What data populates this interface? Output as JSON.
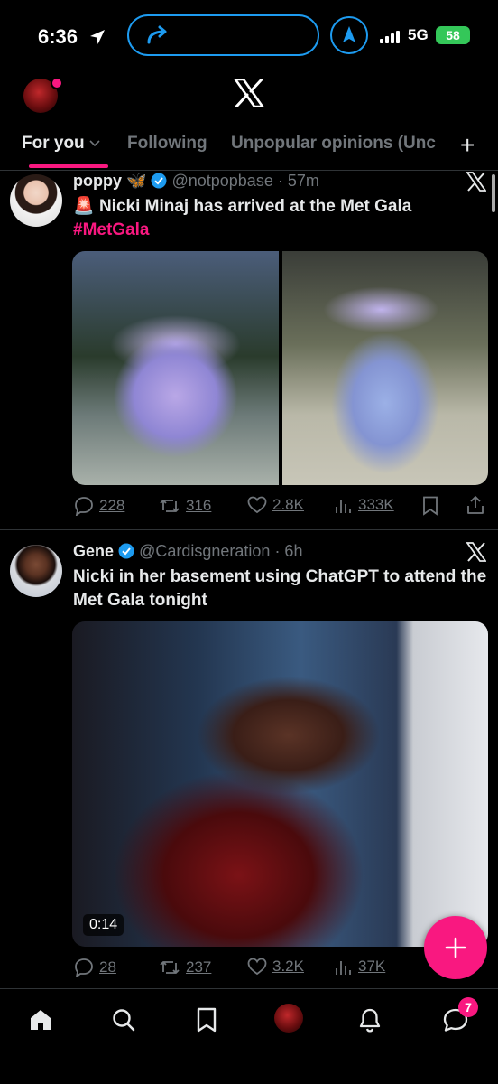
{
  "status_bar": {
    "time": "6:36",
    "network": "5G",
    "battery": "58",
    "icons": [
      "location-arrow-icon",
      "share-arrow-icon",
      "navigation-icon",
      "signal-bars-icon",
      "battery-icon"
    ]
  },
  "header": {
    "logo": "x-logo-icon",
    "notification_dot_color": "#f91880"
  },
  "tabs": [
    {
      "label": "For you",
      "active": true
    },
    {
      "label": "Following",
      "active": false
    },
    {
      "label": "Unpopular opinions (Unc",
      "active": false
    }
  ],
  "tabs_add_label": "+",
  "tweets": [
    {
      "name": "poppy",
      "name_suffix": "🦋",
      "verified": true,
      "handle": "@notpopbase",
      "time": "· 57m",
      "emoji": "🚨",
      "text": "Nicki Minaj has arrived at the Met Gala",
      "hashtag": "#MetGala",
      "replies": "228",
      "reposts": "316",
      "likes": "2.8K",
      "views": "333K"
    },
    {
      "name": "Gene",
      "verified": true,
      "handle": "@Cardisgneration",
      "time": "· 6h",
      "text": "Nicki in her basement using ChatGPT to attend the Met Gala tonight",
      "video_duration": "0:14",
      "replies": "28",
      "reposts": "237",
      "likes": "3.2K",
      "views": "37K"
    }
  ],
  "fab_label": "+",
  "bottom_nav": {
    "items": [
      "home-icon",
      "search-icon",
      "bookmark-icon",
      "profile-avatar",
      "notifications-icon",
      "messages-icon"
    ],
    "messages_badge": "7"
  },
  "colors": {
    "accent": "#f91880",
    "verified": "#1d9bf0",
    "muted": "#71767b",
    "background": "#000000"
  }
}
